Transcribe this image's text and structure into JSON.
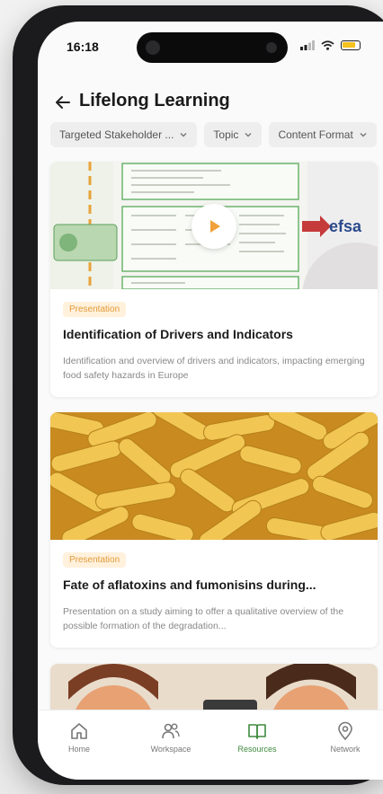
{
  "status": {
    "time": "16:18"
  },
  "header": {
    "title": "Lifelong Learning"
  },
  "filters": [
    {
      "label": "Targeted Stakeholder ..."
    },
    {
      "label": "Topic"
    },
    {
      "label": "Content Format"
    }
  ],
  "cards": [
    {
      "badge": "Presentation",
      "title": "Identification of Drivers and Indicators",
      "description": "Identification and overview of drivers and indicators, impacting emerging food safety hazards in Europe",
      "thumb_text": "efsa"
    },
    {
      "badge": "Presentation",
      "title": "Fate of aflatoxins and fumonisins during...",
      "description": "Presentation on a study aiming to offer a qualitative overview of the possible formation of the degradation..."
    }
  ],
  "tabs": [
    {
      "label": "Home",
      "icon": "home-icon"
    },
    {
      "label": "Workspace",
      "icon": "users-icon"
    },
    {
      "label": "Resources",
      "icon": "book-icon",
      "active": true
    },
    {
      "label": "Network",
      "icon": "location-pin-icon"
    }
  ],
  "colors": {
    "accent_green": "#3f8a3f",
    "badge_bg": "#fff1dc",
    "badge_text": "#e39b3a",
    "play_orange": "#f0a13b"
  }
}
